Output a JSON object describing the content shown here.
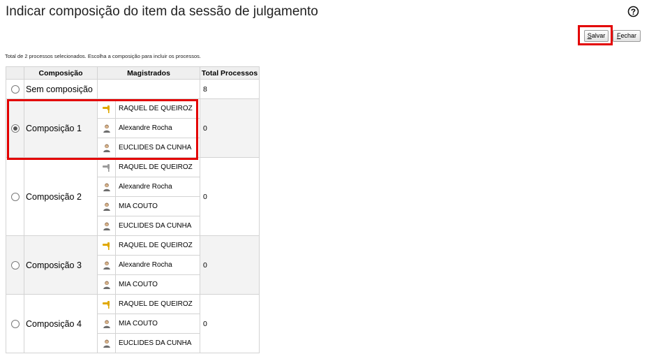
{
  "page": {
    "title": "Indicar composição do item da sessão de julgamento",
    "info": "Total de 2 processos selecionados. Escolha a composição para incluir os processos."
  },
  "buttons": {
    "salvar": {
      "mnemonic": "S",
      "rest": "alvar"
    },
    "fechar": {
      "mnemonic": "F",
      "rest": "echar"
    }
  },
  "table": {
    "headers": [
      "Composição",
      "Magistrados",
      "Total Processos"
    ],
    "rows": [
      {
        "name": "Sem composição",
        "total": "8",
        "selected": false,
        "members": []
      },
      {
        "name": "Composição 1",
        "total": "0",
        "selected": true,
        "members": [
          {
            "name": "RAQUEL DE QUEIROZ",
            "role": "relator",
            "icon": "gavel-icon-gold"
          },
          {
            "name": "Alexandre Rocha",
            "role": "vogal",
            "icon": "person-icon"
          },
          {
            "name": "EUCLIDES DA CUNHA",
            "role": "vogal",
            "icon": "person-icon"
          }
        ]
      },
      {
        "name": "Composição 2",
        "total": "0",
        "selected": false,
        "members": [
          {
            "name": "RAQUEL DE QUEIROZ",
            "role": "relator",
            "icon": "gavel-icon-gray"
          },
          {
            "name": "Alexandre Rocha",
            "role": "vogal",
            "icon": "person-icon"
          },
          {
            "name": "MIA COUTO",
            "role": "vogal",
            "icon": "person-icon"
          },
          {
            "name": "EUCLIDES DA CUNHA",
            "role": "vogal",
            "icon": "person-icon"
          }
        ]
      },
      {
        "name": "Composição 3",
        "total": "0",
        "selected": false,
        "members": [
          {
            "name": "RAQUEL DE QUEIROZ",
            "role": "relator",
            "icon": "gavel-icon-gold"
          },
          {
            "name": "Alexandre Rocha",
            "role": "vogal",
            "icon": "person-icon"
          },
          {
            "name": "MIA COUTO",
            "role": "vogal",
            "icon": "person-icon"
          }
        ]
      },
      {
        "name": "Composição 4",
        "total": "0",
        "selected": false,
        "members": [
          {
            "name": "RAQUEL DE QUEIROZ",
            "role": "relator",
            "icon": "gavel-icon-gold"
          },
          {
            "name": "MIA COUTO",
            "role": "vogal",
            "icon": "person-icon"
          },
          {
            "name": "EUCLIDES DA CUNHA",
            "role": "vogal",
            "icon": "person-icon"
          }
        ]
      }
    ]
  },
  "colors": {
    "highlight": "#e30000",
    "header_bg": "#efefef",
    "shaded_row": "#f3f3f3",
    "border": "#d3d3d3"
  }
}
